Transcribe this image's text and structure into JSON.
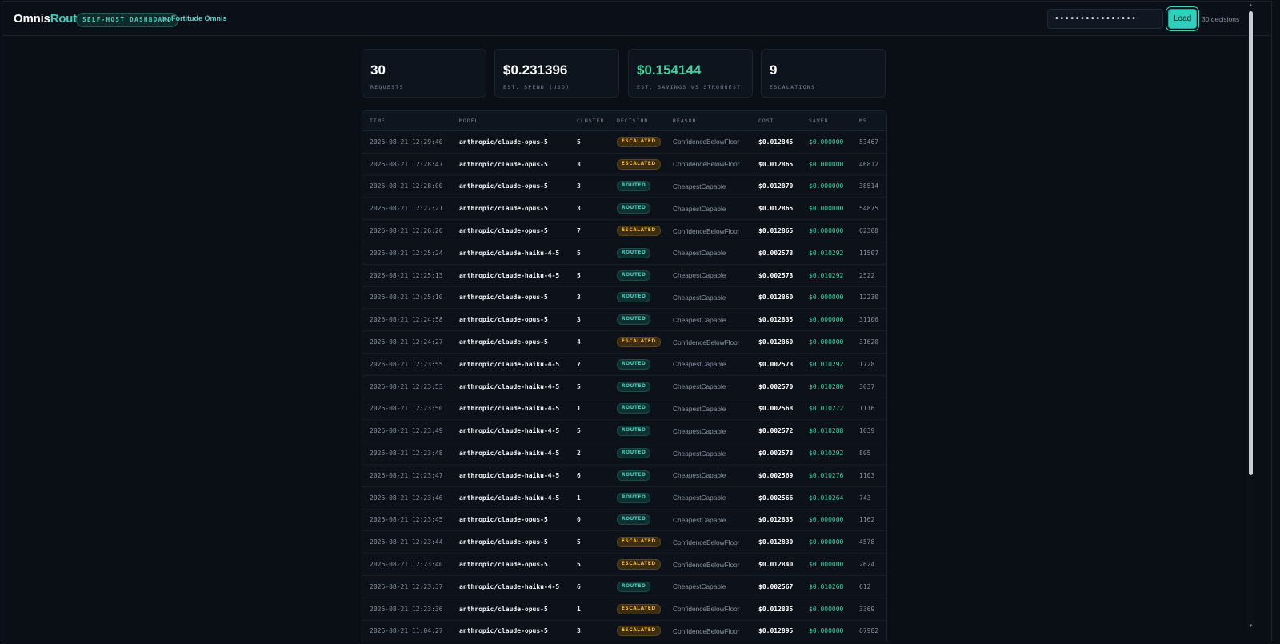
{
  "header": {
    "brand_prefix": "Omnis",
    "brand_suffix": "Router",
    "badge": "SELF-HOST DASHBOARD",
    "by_text": "by",
    "by_link": "Fortitude Omnis",
    "key_value": "••••••••••••••••",
    "load_label": "Load",
    "decisions_count": "30 decisions"
  },
  "stats": [
    {
      "value": "30",
      "label": "REQUESTS"
    },
    {
      "value": "$0.231396",
      "label": "EST. SPEND (USD)"
    },
    {
      "value": "$0.154144",
      "label": "EST. SAVINGS VS STRONGEST"
    },
    {
      "value": "9",
      "label": "ESCALATIONS"
    }
  ],
  "table": {
    "columns": [
      "TIME",
      "MODEL",
      "CLUSTER",
      "DECISION",
      "REASON",
      "COST",
      "SAVED",
      "MS"
    ],
    "rows": [
      [
        "2026-08-21 12:29:40",
        "anthropic/claude-opus-5",
        "5",
        "ESCALATED",
        "ConfidenceBelowFloor",
        "$0.012845",
        "$0.000000",
        "53467"
      ],
      [
        "2026-08-21 12:28:47",
        "anthropic/claude-opus-5",
        "3",
        "ESCALATED",
        "ConfidenceBelowFloor",
        "$0.012865",
        "$0.000000",
        "46812"
      ],
      [
        "2026-08-21 12:28:00",
        "anthropic/claude-opus-5",
        "3",
        "ROUTED",
        "CheapestCapable",
        "$0.012870",
        "$0.000000",
        "38514"
      ],
      [
        "2026-08-21 12:27:21",
        "anthropic/claude-opus-5",
        "3",
        "ROUTED",
        "CheapestCapable",
        "$0.012865",
        "$0.000000",
        "54875"
      ],
      [
        "2026-08-21 12:26:26",
        "anthropic/claude-opus-5",
        "7",
        "ESCALATED",
        "ConfidenceBelowFloor",
        "$0.012865",
        "$0.000000",
        "62308"
      ],
      [
        "2026-08-21 12:25:24",
        "anthropic/claude-haiku-4-5",
        "5",
        "ROUTED",
        "CheapestCapable",
        "$0.002573",
        "$0.010292",
        "11507"
      ],
      [
        "2026-08-21 12:25:13",
        "anthropic/claude-haiku-4-5",
        "5",
        "ROUTED",
        "CheapestCapable",
        "$0.002573",
        "$0.010292",
        "2522"
      ],
      [
        "2026-08-21 12:25:10",
        "anthropic/claude-opus-5",
        "3",
        "ROUTED",
        "CheapestCapable",
        "$0.012860",
        "$0.000000",
        "12230"
      ],
      [
        "2026-08-21 12:24:58",
        "anthropic/claude-opus-5",
        "3",
        "ROUTED",
        "CheapestCapable",
        "$0.012835",
        "$0.000000",
        "31106"
      ],
      [
        "2026-08-21 12:24:27",
        "anthropic/claude-opus-5",
        "4",
        "ESCALATED",
        "ConfidenceBelowFloor",
        "$0.012860",
        "$0.000000",
        "31620"
      ],
      [
        "2026-08-21 12:23:55",
        "anthropic/claude-haiku-4-5",
        "7",
        "ROUTED",
        "CheapestCapable",
        "$0.002573",
        "$0.010292",
        "1728"
      ],
      [
        "2026-08-21 12:23:53",
        "anthropic/claude-haiku-4-5",
        "5",
        "ROUTED",
        "CheapestCapable",
        "$0.002570",
        "$0.010280",
        "3037"
      ],
      [
        "2026-08-21 12:23:50",
        "anthropic/claude-haiku-4-5",
        "1",
        "ROUTED",
        "CheapestCapable",
        "$0.002568",
        "$0.010272",
        "1116"
      ],
      [
        "2026-08-21 12:23:49",
        "anthropic/claude-haiku-4-5",
        "5",
        "ROUTED",
        "CheapestCapable",
        "$0.002572",
        "$0.010288",
        "1039"
      ],
      [
        "2026-08-21 12:23:48",
        "anthropic/claude-haiku-4-5",
        "2",
        "ROUTED",
        "CheapestCapable",
        "$0.002573",
        "$0.010292",
        "805"
      ],
      [
        "2026-08-21 12:23:47",
        "anthropic/claude-haiku-4-5",
        "6",
        "ROUTED",
        "CheapestCapable",
        "$0.002569",
        "$0.010276",
        "1103"
      ],
      [
        "2026-08-21 12:23:46",
        "anthropic/claude-haiku-4-5",
        "1",
        "ROUTED",
        "CheapestCapable",
        "$0.002566",
        "$0.010264",
        "743"
      ],
      [
        "2026-08-21 12:23:45",
        "anthropic/claude-opus-5",
        "0",
        "ROUTED",
        "CheapestCapable",
        "$0.012835",
        "$0.000000",
        "1162"
      ],
      [
        "2026-08-21 12:23:44",
        "anthropic/claude-opus-5",
        "5",
        "ESCALATED",
        "ConfidenceBelowFloor",
        "$0.012830",
        "$0.000000",
        "4578"
      ],
      [
        "2026-08-21 12:23:40",
        "anthropic/claude-opus-5",
        "5",
        "ESCALATED",
        "ConfidenceBelowFloor",
        "$0.012840",
        "$0.000000",
        "2624"
      ],
      [
        "2026-08-21 12:23:37",
        "anthropic/claude-haiku-4-5",
        "6",
        "ROUTED",
        "CheapestCapable",
        "$0.002567",
        "$0.010268",
        "612"
      ],
      [
        "2026-08-21 12:23:36",
        "anthropic/claude-opus-5",
        "1",
        "ESCALATED",
        "ConfidenceBelowFloor",
        "$0.012835",
        "$0.000000",
        "3369"
      ],
      [
        "2026-08-21 11:04:27",
        "anthropic/claude-opus-5",
        "3",
        "ESCALATED",
        "ConfidenceBelowFloor",
        "$0.012895",
        "$0.000000",
        "67982"
      ]
    ]
  },
  "colors": {
    "background": "#0a0e15",
    "accent": "#2fd0bb",
    "saved_green": "#3ed3a1",
    "escalated": "#f0b63c"
  }
}
